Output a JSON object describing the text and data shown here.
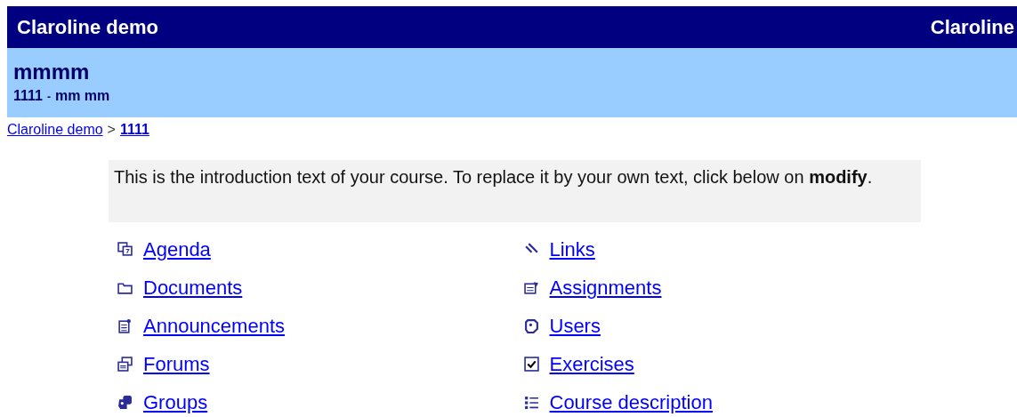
{
  "header": {
    "site_title": "Claroline demo",
    "site_title_right": "Claroline"
  },
  "course": {
    "title": "mmmm",
    "code": "1111",
    "separator": "-",
    "teachers": "mm mm"
  },
  "breadcrumb": [
    {
      "label": "Claroline demo",
      "current": false
    },
    {
      "label": "1111",
      "current": true
    }
  ],
  "breadcrumb_separator": ">",
  "intro": "This is the introduction text of your course. To replace it by your own text, click below on **modify**.",
  "tools": [
    {
      "label": "Agenda"
    },
    {
      "label": "Links"
    },
    {
      "label": "Documents"
    },
    {
      "label": "Assignments"
    },
    {
      "label": "Announcements"
    },
    {
      "label": "Users"
    },
    {
      "label": "Forums"
    },
    {
      "label": "Exercises"
    },
    {
      "label": "Groups"
    },
    {
      "label": "Course description"
    }
  ]
}
